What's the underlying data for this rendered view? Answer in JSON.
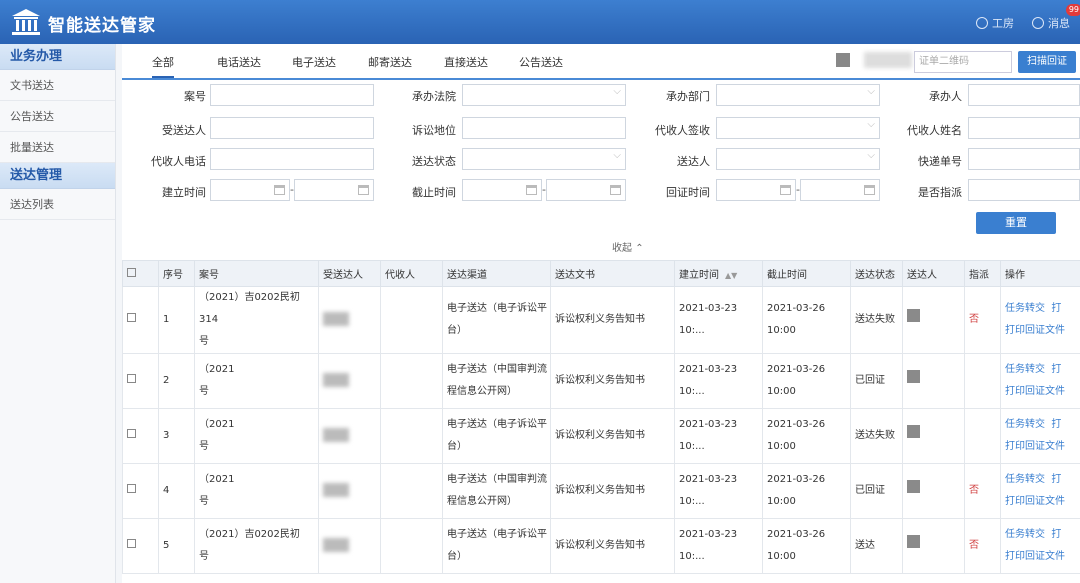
{
  "app": {
    "title": "智能送达管家"
  },
  "header": {
    "workbench_label": "工房",
    "message_label": "消息",
    "message_count": "99"
  },
  "sidebar": {
    "sections": [
      {
        "title": "业务办理",
        "items": [
          "文书送达",
          "公告送达",
          "批量送达"
        ]
      },
      {
        "title": "送达管理",
        "items": [
          "送达列表"
        ]
      }
    ]
  },
  "tabs": [
    "全部",
    "电话送达",
    "电子送达",
    "邮寄送达",
    "直接送达",
    "公告送达"
  ],
  "toolbar": {
    "qr_placeholder": "证单二维码",
    "scan_label": "扫描回证"
  },
  "form": {
    "labels": [
      "案号",
      "承办法院",
      "承办部门",
      "承办人",
      "受送达人",
      "诉讼地位",
      "代收人签收",
      "代收人姓名",
      "代收人电话",
      "送达状态",
      "送达人",
      "快递单号",
      "建立时间",
      "截止时间",
      "回证时间",
      "是否指派"
    ],
    "reset_label": "重置",
    "collapse_label": "收起"
  },
  "table": {
    "headers": [
      "序号",
      "案号",
      "受送达人",
      "代收人",
      "送达渠道",
      "送达文书",
      "建立时间",
      "截止时间",
      "送达状态",
      "送达人",
      "指派",
      "操作"
    ],
    "rows": [
      {
        "no": "1",
        "case": "（2021）吉0202民初314",
        "case2": "号",
        "channel": "电子送达（电子诉讼平台）",
        "doc": "诉讼权利义务告知书",
        "created": "2021-03-23 10:...",
        "deadline": "2021-03-26 10:00",
        "status": "送达失败",
        "assigned": "否",
        "op1": "任务转交",
        "op1b": "打",
        "op2": "打印回证文件"
      },
      {
        "no": "2",
        "case": "（2021",
        "case2": "号",
        "channel": "电子送达（中国审判流程信息公开网）",
        "doc": "诉讼权利义务告知书",
        "created": "2021-03-23 10:...",
        "deadline": "2021-03-26 10:00",
        "status": "已回证",
        "assigned": "",
        "op1": "任务转交",
        "op1b": "打",
        "op2": "打印回证文件"
      },
      {
        "no": "3",
        "case": "（2021",
        "case2": "号",
        "channel": "电子送达（电子诉讼平台）",
        "doc": "诉讼权利义务告知书",
        "created": "2021-03-23 10:...",
        "deadline": "2021-03-26 10:00",
        "status": "送达失败",
        "assigned": "",
        "op1": "任务转交",
        "op1b": "打",
        "op2": "打印回证文件"
      },
      {
        "no": "4",
        "case": "（2021",
        "case2": "号",
        "channel": "电子送达（中国审判流程信息公开网）",
        "doc": "诉讼权利义务告知书",
        "created": "2021-03-23 10:...",
        "deadline": "2021-03-26 10:00",
        "status": "已回证",
        "assigned": "否",
        "op1": "任务转交",
        "op1b": "打",
        "op2": "打印回证文件"
      },
      {
        "no": "5",
        "case": "（2021）吉0202民初",
        "case2": "号",
        "channel": "电子送达（电子诉讼平台）",
        "doc": "诉讼权利义务告知书",
        "created": "2021-03-23 10:...",
        "deadline": "2021-03-26 10:00",
        "status": "送达",
        "assigned": "否",
        "op1": "任务转交",
        "op1b": "打",
        "op2": "打印回证文件"
      }
    ]
  },
  "colors": {
    "header": "#2a63b4",
    "accent": "#3a7fd0",
    "fail": "#d04040"
  }
}
